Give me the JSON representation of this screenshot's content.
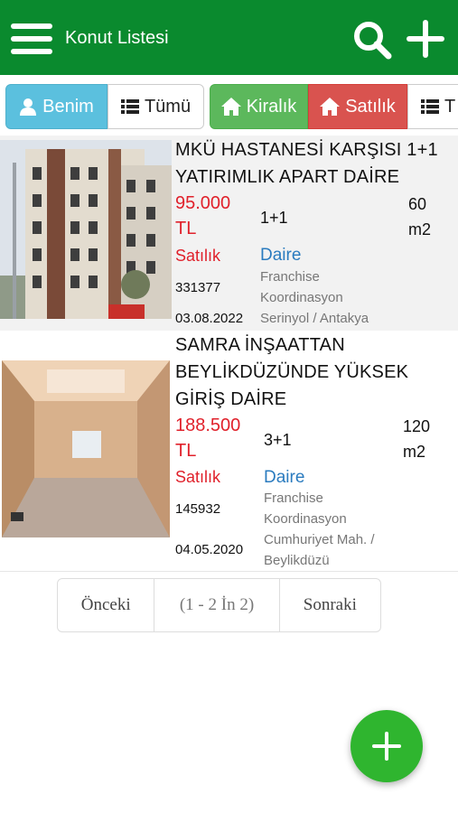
{
  "header": {
    "title": "Konut Listesi",
    "background": "#0a8a2e",
    "icons": [
      "menu-icon",
      "search-icon",
      "plus-icon"
    ]
  },
  "filters": {
    "benim": "Benim",
    "tumu": "Tümü",
    "kiralik": "Kiralık",
    "satilik": "Satılık",
    "tipi": "T"
  },
  "listings": [
    {
      "title": "MKÜ HASTANESİ KARŞISI 1+1 YATIRIMLIK APART DAİRE",
      "price_amount": "95.000",
      "price_currency": "TL",
      "rooms": "1+1",
      "area_value": "60",
      "area_unit": "m2",
      "status": "Satılık",
      "type": "Daire",
      "code": "331377",
      "agency_1": "Franchise",
      "agency_2": "Koordinasyon",
      "location": "Serinyol / Antakya",
      "date": "03.08.2022"
    },
    {
      "title": "SAMRA İNŞAATTAN BEYLİKDÜZÜNDE YÜKSEK GİRİŞ DAİRE",
      "price_amount": "188.500",
      "price_currency": "TL",
      "rooms": "3+1",
      "area_value": "120",
      "area_unit": "m2",
      "status": "Satılık",
      "type": "Daire",
      "code": "145932",
      "agency_1": "Franchise",
      "agency_2": "Koordinasyon",
      "location_1": "Cumhuriyet Mah. /",
      "location_2": "Beylikdüzü",
      "date": "04.05.2020"
    }
  ],
  "pagination": {
    "prev": "Önceki",
    "info": "(1 - 2 İn 2)",
    "next": "Sonraki"
  },
  "colors": {
    "accent_green": "#0a8a2e",
    "price_red": "#e0212b",
    "type_blue": "#2a7bbf",
    "fab_green": "#2fb52f"
  }
}
